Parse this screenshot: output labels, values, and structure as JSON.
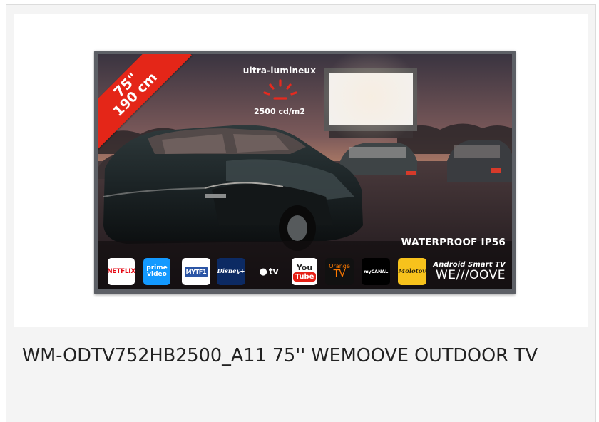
{
  "product": {
    "title": "WM-ODTV752HB2500_A11 75'' WEMOOVE OUTDOOR TV"
  },
  "image": {
    "size_banner": {
      "inches": "75\"",
      "cm": "190 cm",
      "color": "#e42618"
    },
    "luminosity": {
      "title": "ultra-lumineux",
      "value": "2500 cd/m2",
      "icon": "brightness-icon"
    },
    "waterproof": "WATERPROOF IP56",
    "apps": [
      {
        "id": "netflix",
        "label": "NETFLIX"
      },
      {
        "id": "prime",
        "label_line1": "prime",
        "label_line2": "video"
      },
      {
        "id": "nyt",
        "label": "MYTF1"
      },
      {
        "id": "disney",
        "label": "Disney+"
      },
      {
        "id": "appletv",
        "label": "tv"
      },
      {
        "id": "youtube",
        "label_top": "You",
        "label_bottom": "Tube"
      },
      {
        "id": "orange",
        "label_top": "Orange",
        "label_bottom": "TV"
      },
      {
        "id": "canal",
        "label": "myCANAL"
      },
      {
        "id": "molotov",
        "label": "Molotov"
      }
    ],
    "brand": {
      "android": "Android Smart TV",
      "wemoove": "WE///OOVE"
    }
  }
}
